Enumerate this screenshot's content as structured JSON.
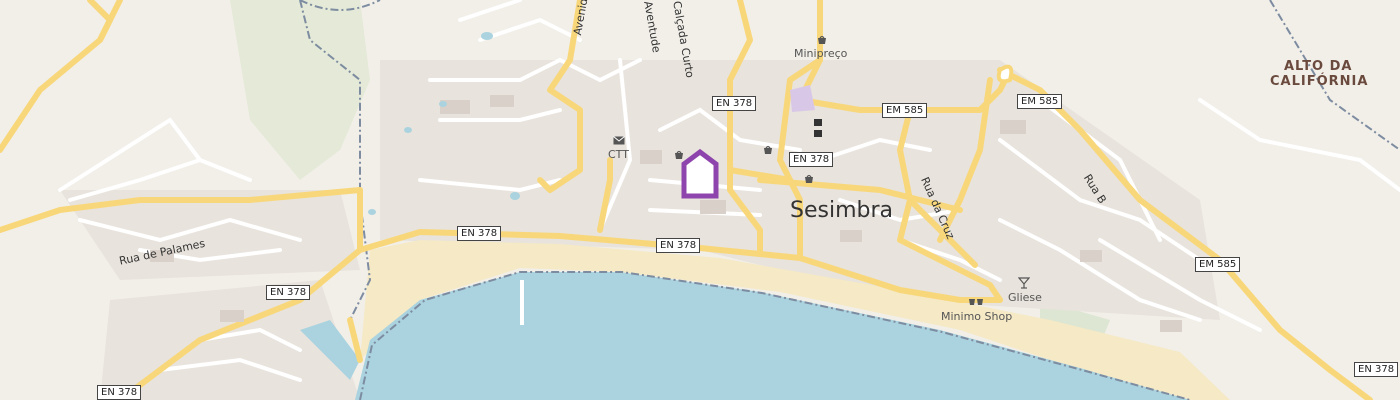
{
  "map": {
    "town": "Sesimbra",
    "region": "ALTO DA\nCALIFÓRNIA",
    "region_line1": "ALTO DA",
    "region_line2": "CALIFÓRNIA",
    "shields": {
      "s1": "EN 378",
      "s2": "EN 378",
      "s3": "EN 378",
      "s4": "EN 378",
      "s5": "EN 378",
      "s6": "EN 378",
      "s7": "EM 585",
      "s8": "EM 585",
      "s9": "EM 585",
      "s10": "EN 378"
    },
    "roads": {
      "palames": "Rua de Palames",
      "cruz": "Rua da Cruz",
      "rua_b": "Rua B",
      "avenida": "Avenida",
      "curto": "Calçada Curto",
      "aventude": "Aventude"
    },
    "pois": {
      "minipreco": "Minipreço",
      "ctt": "CTT",
      "gliese": "Gliese",
      "minimo": "Minimo Shop"
    },
    "colors": {
      "land": "#f2efe9",
      "water": "#aad3df",
      "beach": "#f5e9c6",
      "road_major": "#f8d77b",
      "marker": "#8e44ad"
    }
  }
}
